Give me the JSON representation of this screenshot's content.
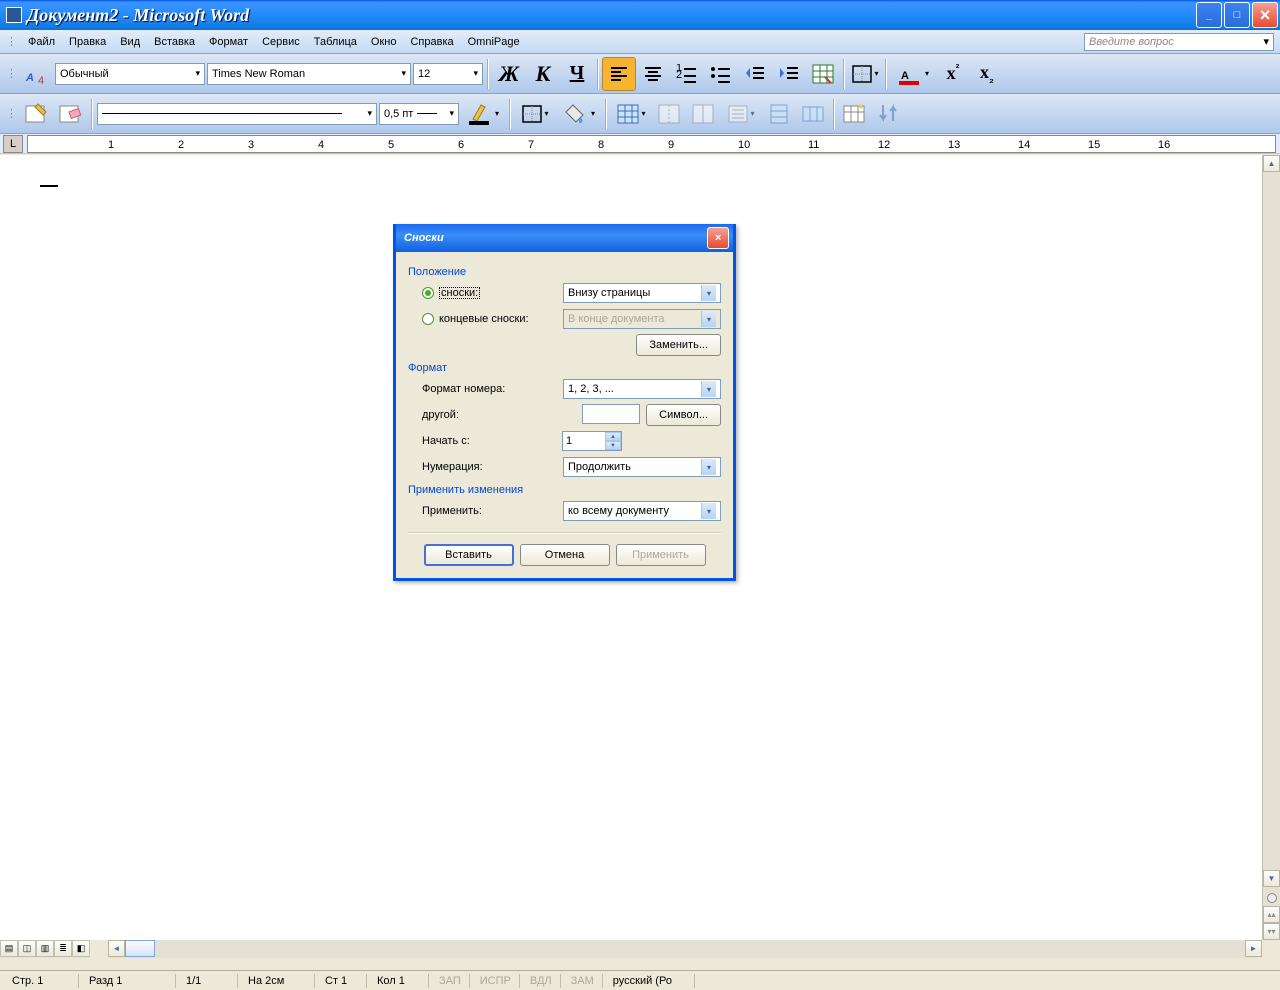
{
  "window": {
    "title": "Документ2 - Microsoft Word"
  },
  "menu": {
    "items": [
      "Файл",
      "Правка",
      "Вид",
      "Вставка",
      "Формат",
      "Сервис",
      "Таблица",
      "Окно",
      "Справка",
      "OmniPage"
    ],
    "help_placeholder": "Введите вопрос"
  },
  "toolbar1": {
    "style": "Обычный",
    "font": "Times New Roman",
    "size": "12"
  },
  "toolbar2": {
    "line_weight": "0,5 пт"
  },
  "dialog": {
    "title": "Сноски",
    "sections": {
      "position": "Положение",
      "format": "Формат",
      "apply": "Применить изменения"
    },
    "radio_footnotes": "сноски:",
    "radio_endnotes": "концевые сноски:",
    "footnote_pos": "Внизу страницы",
    "endnote_pos": "В конце документа",
    "btn_replace": "Заменить...",
    "lbl_num_format": "Формат номера:",
    "num_format": "1, 2, 3, ...",
    "lbl_other": "другой:",
    "btn_symbol": "Символ...",
    "lbl_start": "Начать с:",
    "start_at": "1",
    "lbl_numbering": "Нумерация:",
    "numbering": "Продолжить",
    "lbl_apply_to": "Применить:",
    "apply_to": "ко всему документу",
    "btn_insert": "Вставить",
    "btn_cancel": "Отмена",
    "btn_apply": "Применить"
  },
  "status": {
    "page": "Стр. 1",
    "section": "Разд 1",
    "pages": "1/1",
    "at": "На 2см",
    "line": "Ст 1",
    "col": "Кол 1",
    "rec": "ЗАП",
    "trk": "ИСПР",
    "ext": "ВДЛ",
    "ovr": "ЗАМ",
    "lang": "русский (Ро"
  }
}
